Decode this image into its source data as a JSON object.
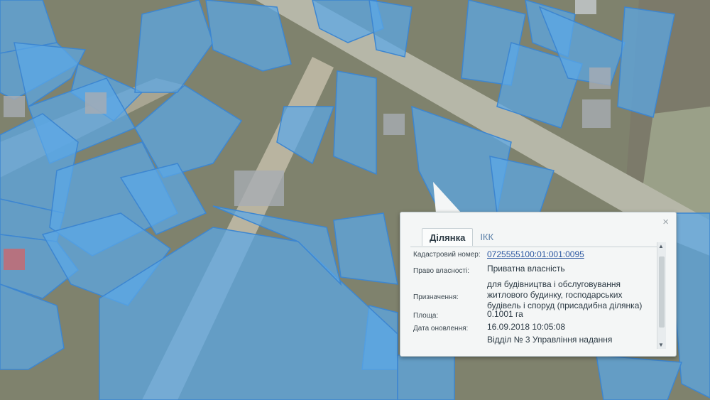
{
  "popup": {
    "close_glyph": "×",
    "tabs": [
      {
        "label": "Ділянка"
      },
      {
        "label": "ІКК"
      }
    ],
    "fields": [
      {
        "label": "Кадастровий номер:",
        "value": "0725555100:01:001:0095"
      },
      {
        "label": "Право власності:",
        "value": "Приватна власність"
      },
      {
        "label": "Призначення:",
        "value": "для будівництва і обслуговування житлового будинку, господарських будівель і споруд (присадибна ділянка)"
      },
      {
        "label": "Площа:",
        "value": "0.1001 га"
      },
      {
        "label": "Дата оновлення:",
        "value": "16.09.2018 10:05:08"
      },
      {
        "label": "",
        "value": "Відділ № 3 Управління надання"
      }
    ]
  },
  "colors": {
    "parcel_fill": "#5aa7e8",
    "road": "#cfc6b2",
    "popup_bg": "#f4f6f6"
  }
}
